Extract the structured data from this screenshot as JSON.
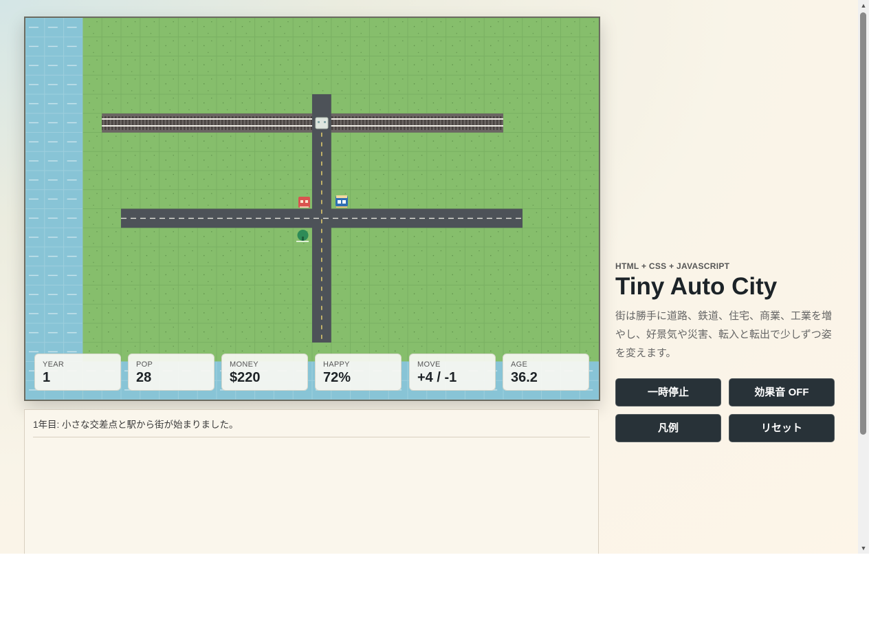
{
  "app": {
    "kicker": "HTML + CSS + JAVASCRIPT",
    "title": "Tiny Auto City",
    "description": "街は勝手に道路、鉄道、住宅、商業、工業を増やし、好景気や災害、転入と転出で少しずつ姿を変えます。"
  },
  "stats": [
    {
      "label": "YEAR",
      "value": "1"
    },
    {
      "label": "POP",
      "value": "28"
    },
    {
      "label": "MONEY",
      "value": "$220"
    },
    {
      "label": "HAPPY",
      "value": "72%"
    },
    {
      "label": "MOVE",
      "value": "+4 / -1"
    },
    {
      "label": "AGE",
      "value": "36.2"
    }
  ],
  "controls": {
    "pause": "一時停止",
    "sound": "効果音 OFF",
    "legend": "凡例",
    "reset": "リセット"
  },
  "log": [
    "1年目: 小さな交差点と駅から街が始まりました。"
  ],
  "map": {
    "buildings": [
      {
        "type": "commercial",
        "color": "#d9534f",
        "icon": "shop-icon"
      },
      {
        "type": "residential",
        "color": "#2f6fb3",
        "icon": "house-icon"
      },
      {
        "type": "park",
        "color": "#2e8b57",
        "icon": "tree-icon"
      },
      {
        "type": "station",
        "color": "#dfe6df",
        "icon": "station-icon"
      }
    ],
    "colors": {
      "grass": "#86be6c",
      "water": "#88c4d6",
      "road": "#4d5258",
      "rail": "#6b6563",
      "lane": "#f0d770"
    }
  }
}
